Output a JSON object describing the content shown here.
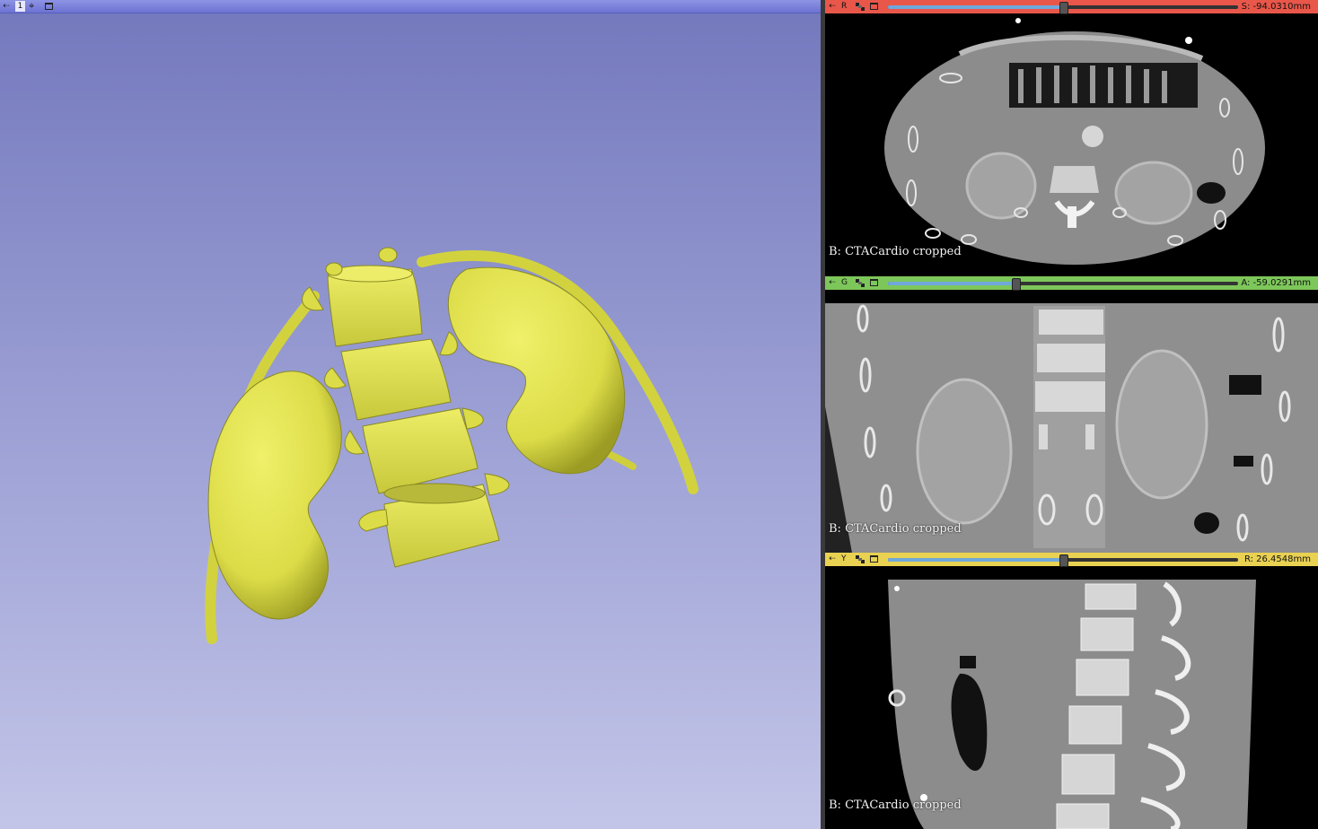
{
  "view3d": {
    "number": "1",
    "pin_icon": "pin-icon",
    "center_icon": "crosshair-icon",
    "maximize_icon": "maximize-icon",
    "model_color": "#e6e655",
    "background_top": "#7378bd",
    "background_bottom": "#c3c5e8"
  },
  "slices": {
    "red": {
      "letter": "R",
      "color": "#e8574a",
      "coord": "S: -94.0310mm",
      "label": "B: CTACardio cropped",
      "slider": 0.5
    },
    "green": {
      "letter": "G",
      "color": "#7dc75a",
      "coord": "A: -59.0291mm",
      "label": "B: CTACardio cropped",
      "slider": 0.365
    },
    "yellow": {
      "letter": "Y",
      "color": "#e9d152",
      "coord": "R: 26.4548mm",
      "label": "B: CTACardio cropped",
      "slider": 0.5
    }
  }
}
